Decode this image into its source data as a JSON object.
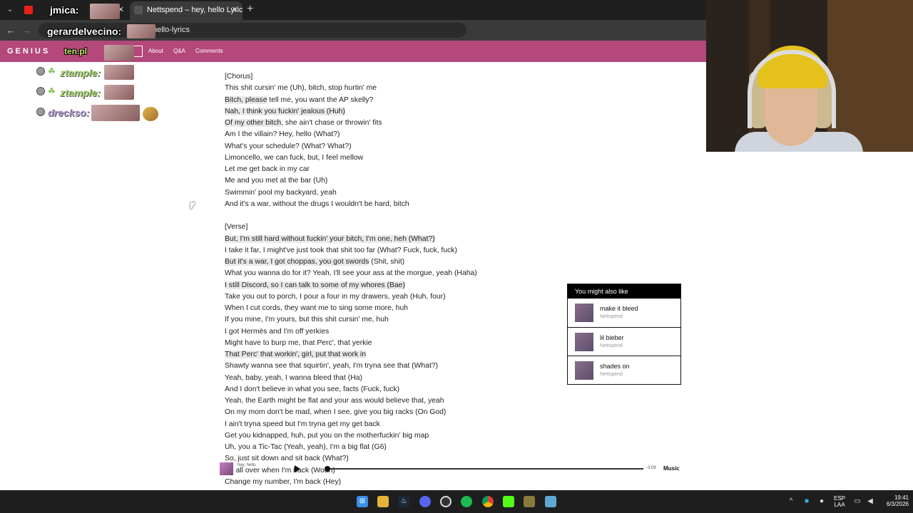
{
  "browser": {
    "tabs": [
      {
        "title": "",
        "active": false
      },
      {
        "title": "Nettspend – hey, hello Lyrics | G",
        "active": true
      }
    ],
    "url_suffix": "hello-lyrics"
  },
  "genius": {
    "logo": "GENIUS",
    "nav": [
      "About",
      "Q&A",
      "Comments"
    ]
  },
  "overlay": {
    "users": [
      "jmica:",
      "gerardelvecino:",
      "ten.pl"
    ],
    "chat": [
      "ztample:",
      "ztample:",
      "dreckso:"
    ]
  },
  "lyrics": [
    {
      "t": "[Chorus]"
    },
    {
      "t": "This shit cursin' me (Uh), bitch, stop hurtin' me"
    },
    {
      "t": "Bitch, please tell me, you want the AP skelly?",
      "hl": "Bitch, please"
    },
    {
      "t": "Nah, I think you fuckin' jealous (Huh)",
      "hl": "all"
    },
    {
      "t": "Of my other bitch, she ain't chase or throwin' fits",
      "hl": "Of my other bitch"
    },
    {
      "t": "Am I the villain? Hey, hello (What?)"
    },
    {
      "t": "What's your schedule? (What? What?)"
    },
    {
      "t": "Limoncello, we can fuck, but, I feel mellow"
    },
    {
      "t": "Let me get back in my car"
    },
    {
      "t": "Me and you met at the bar (Uh)"
    },
    {
      "t": "Swimmin' pool my backyard, yeah"
    },
    {
      "t": "And it's a war, without the drugs I wouldn't be hard, bitch"
    },
    {
      "t": ""
    },
    {
      "t": "[Verse]"
    },
    {
      "t": "But, I'm still hard without fuckin' your bitch, I'm one, heh (What?)",
      "hl": "all"
    },
    {
      "t": "I take it far, I might've just took that shit too far (What? Fuck, fuck, fuck)"
    },
    {
      "t": "But it's a war, I got choppas, you got swords (Shit, shit)",
      "hl": "But it's a war, I got choppas, you got swords"
    },
    {
      "t": "What you wanna do for it? Yeah, I'll see your ass at the morgue, yeah (Haha)"
    },
    {
      "t": "I still Discord, so I can talk to some of my whores (Bae)",
      "hl": "all"
    },
    {
      "t": "Take you out to porch, I pour a four in my drawers, yeah (Huh, four)"
    },
    {
      "t": "When I cut cords, they want me to sing some more, huh"
    },
    {
      "t": "If you mine, I'm yours, but this shit cursin' me, huh"
    },
    {
      "t": "I got Hermès and I'm off yerkies"
    },
    {
      "t": "Might have to burp me, that Perc', that yerkie"
    },
    {
      "t": "That Perc' that workin', girl, put that work in",
      "hl": "all"
    },
    {
      "t": "Shawty wanna see that squirtin', yeah, I'm tryna see that (What?)"
    },
    {
      "t": "Yeah, baby, yeah, I wanna bleed that (Ha)"
    },
    {
      "t": "And I don't believe in what you see, facts (Fuck, fuck)"
    },
    {
      "t": "Yeah, the Earth might be flat and your ass would believe that, yeah"
    },
    {
      "t": "On my mom don't be mad, when I see, give you big racks (On God)"
    },
    {
      "t": "I ain't tryna speed but I'm tryna get my get back"
    },
    {
      "t": "Get you kidnapped, huh, put you on the motherfuckin' big map"
    },
    {
      "t": "Uh, you a Tic-Tac (Yeah, yeah), I'm a big flat (G6)"
    },
    {
      "t": "So, just sit down and sit back (What?)"
    },
    {
      "t": "Be all over when I'm back (Woah)"
    },
    {
      "t": "Change my number, I'm back (Hey)"
    }
  ],
  "also_like": {
    "heading": "You might also like",
    "songs": [
      {
        "title": "make it bleed",
        "artist": "Nettspend"
      },
      {
        "title": "lil bieber",
        "artist": "Nettspend"
      },
      {
        "title": "shades on",
        "artist": "Nettspend"
      }
    ]
  },
  "player": {
    "title": "hey, hello",
    "time": "-3:09",
    "service": "Music"
  },
  "taskbar": {
    "lang": "ESP",
    "lang2": "LAA",
    "time": "19:41",
    "date": "6/3/2026"
  }
}
